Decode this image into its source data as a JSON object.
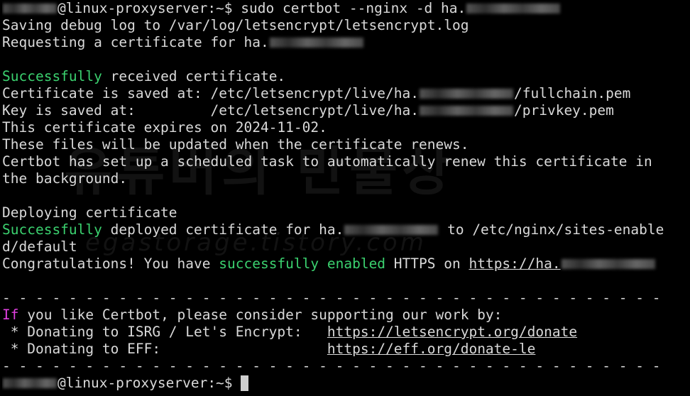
{
  "terminal": {
    "prompt_suffix": "@linux-proxyserver:~$ ",
    "command": "sudo certbot --nginx -d ha.",
    "log_line": "Saving debug log to /var/log/letsencrypt/letsencrypt.log",
    "request_line": "Requesting a certificate for ha.",
    "success_word": "Successfully",
    "received_rest": " received certificate.",
    "cert_saved": "Certificate is saved at: /etc/letsencrypt/live/ha.",
    "fullchain": "/fullchain.pem",
    "key_saved": "Key is saved at:         /etc/letsencrypt/live/ha.",
    "privkey": "/privkey.pem",
    "expires": "This certificate expires on 2024-11-02.",
    "updated": "These files will be updated when the certificate renews.",
    "scheduled_1": "Certbot has set up a scheduled task to automatically renew this certificate in",
    "scheduled_2": "the background.",
    "deploying": "Deploying certificate",
    "deployed_rest": " deployed certificate for ha.",
    "deployed_to": " to /etc/nginx/sites-enable",
    "deployed_wrap": "d/default",
    "congrats_start": "Congratulations! You have ",
    "congrats_green": "successfully enabled",
    "congrats_mid": " HTTPS on ",
    "congrats_link": "https://ha.",
    "separator": "- - - - - - - - - - - - - - - - - - - - - - - - - - - - - - - - - - - - - - - -",
    "if_word": "If",
    "support_rest": " you like Certbot, please consider supporting our work by:",
    "donate_isrg_label": " * Donating to ISRG / Let's Encrypt:   ",
    "donate_isrg_link": "https://letsencrypt.org/donate",
    "donate_eff_label": " * Donating to EFF:                    ",
    "donate_eff_link": "https://eff.org/donate-le"
  },
  "watermark": {
    "main": "유튜버의 만물상",
    "sub": "egastorage.tistory.com"
  },
  "colors": {
    "background": "#000000",
    "text": "#d9d9d9",
    "success": "#3bd16f",
    "if_keyword": "#e040e0"
  }
}
